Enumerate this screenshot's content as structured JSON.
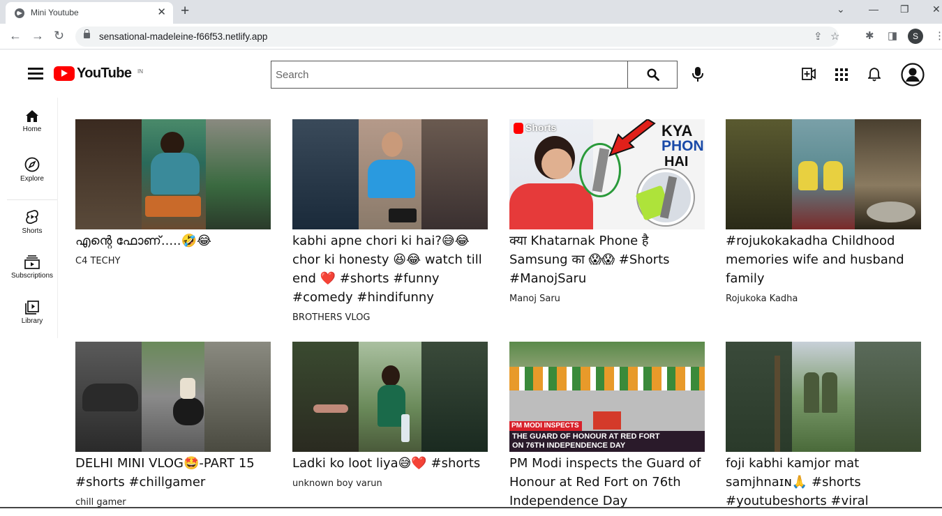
{
  "browser": {
    "tab_title": "Mini Youtube",
    "url": "sensational-madeleine-f66f53.netlify.app",
    "profile_initial": "S"
  },
  "header": {
    "logo_text": "YouTube",
    "logo_region": "IN",
    "search_placeholder": "Search"
  },
  "sidebar": {
    "items": [
      {
        "label": "Home",
        "icon": "home-icon"
      },
      {
        "label": "Explore",
        "icon": "compass-icon"
      },
      {
        "label": "Shorts",
        "icon": "shorts-icon"
      },
      {
        "label": "Subscriptions",
        "icon": "subscriptions-icon"
      },
      {
        "label": "Library",
        "icon": "library-icon"
      }
    ]
  },
  "videos": [
    {
      "title": "എന്റെ ഫോണ്.....🤣😂",
      "channel": "C4 TECHY"
    },
    {
      "title": "kabhi apne chori ki hai?😅😂 chor ki honesty 😆😂 watch till end ❤️ #shorts #funny #comedy #hindifunny",
      "channel": "BROTHERS VLOG"
    },
    {
      "title": "क्या Khatarnak Phone है Samsung का 😱😱 #Shorts #ManojSaru",
      "channel": "Manoj Saru"
    },
    {
      "title": "#rojukokakadha Childhood memories wife and husband family",
      "channel": "Rojukoka Kadha"
    },
    {
      "title": "DELHI MINI VLOG🤩-PART 15 #shorts #chillgamer",
      "channel": "chill gamer"
    },
    {
      "title": "Ladki ko loot liya😅❤️ #shorts",
      "channel": "unknown boy varun"
    },
    {
      "title": "PM Modi inspects the Guard of Honour at Red Fort on 76th Independence Day",
      "channel": ""
    },
    {
      "title": "foji kabhi kamjor mat samjhnaɪɴ🙏 #shorts #youtubeshorts #viral",
      "channel": ""
    }
  ],
  "thumb_text": {
    "shorts_badge": "Shorts",
    "kya_phone_hai": [
      "KYA",
      "PHONE",
      "HAI"
    ],
    "pm_modi_banner_top": "PM MODI INSPECTS",
    "pm_modi_banner_line1": "THE GUARD OF HONOUR AT RED FORT",
    "pm_modi_banner_line2": "ON 76TH INDEPENDENCE DAY"
  },
  "colors": {
    "brand_red": "#ff0000",
    "text": "#111111",
    "chrome_bg": "#dee1e6"
  }
}
